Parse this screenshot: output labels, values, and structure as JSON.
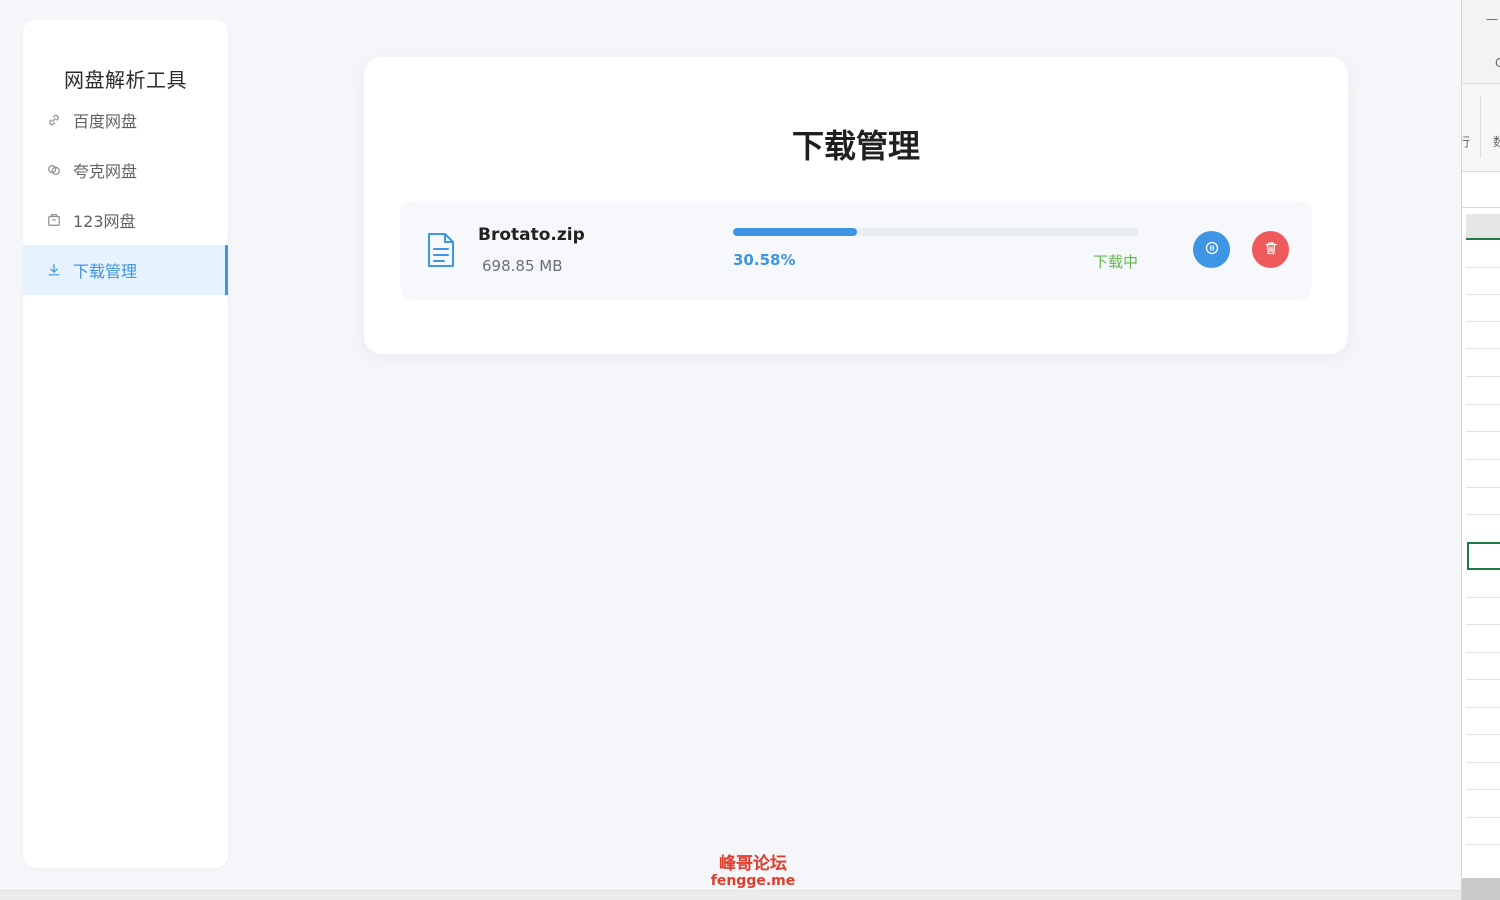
{
  "app": {
    "title": "网盘解析工具"
  },
  "sidebar": {
    "items": [
      {
        "label": "百度网盘",
        "icon": "link-icon",
        "active": false
      },
      {
        "label": "夸克网盘",
        "icon": "chain-circle-icon",
        "active": false
      },
      {
        "label": "123网盘",
        "icon": "storage-box-icon",
        "active": false
      },
      {
        "label": "下载管理",
        "icon": "download-icon",
        "active": true
      }
    ]
  },
  "main": {
    "title": "下载管理",
    "downloads": [
      {
        "file_name": "Brotato.zip",
        "file_size": "698.85 MB",
        "progress_percent": 30.58,
        "progress_label": "30.58%",
        "status": "下载中",
        "actions": [
          "pause-icon",
          "trash-icon"
        ]
      }
    ]
  },
  "right_window": {
    "glyph_top": "—",
    "glyph_c": "C",
    "glyph_left": "行",
    "glyph_right": "数"
  },
  "watermark": {
    "cn": "峰哥论坛",
    "en": "fengge.me"
  },
  "colors": {
    "accent": "#3d95e4",
    "status_green": "#5fb94b",
    "danger": "#ef5b5b",
    "background": "#f4f6f9"
  }
}
